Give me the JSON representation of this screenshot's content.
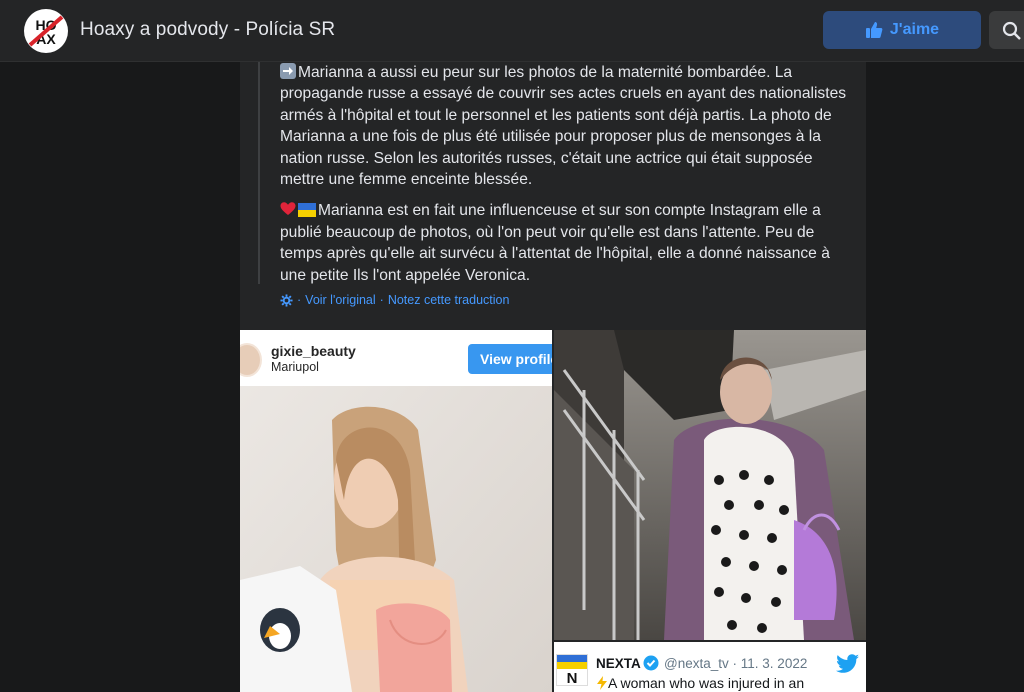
{
  "header": {
    "logo_label": "HOAX",
    "page_name": "Hoaxy a podvody - Polícia SR",
    "like_label": "J'aime",
    "colors": {
      "bar": "#242526",
      "like_bg": "#2d4b7c",
      "like_text": "#4599ff"
    }
  },
  "post": {
    "paragraph1": "Marianna a aussi eu peur sur les photos de la maternité bombardée. La propagande russe a essayé de couvrir ses actes cruels en ayant des nationalistes armés à l'hôpital et tout le personnel et les patients sont déjà partis. La photo de Marianna a une fois de plus été utilisée pour proposer plus de mensonges à la nation russe. Selon les autorités russes, c'était une actrice qui était supposée mettre une femme enceinte blessée.",
    "paragraph1_icon": "right-arrow-emoji",
    "paragraph2": "Marianna est en fait une influenceuse et sur son compte Instagram elle a publié beaucoup de photos, où l'on peut voir qu'elle est dans l'attente. Peu de temps après qu'elle ait survécu à l'attentat de l'hôpital, elle a donné naissance à une petite Ils l'ont appelée Veronica.",
    "paragraph2_icons": [
      "red-heart-emoji",
      "ukraine-flag-emoji"
    ],
    "translation": {
      "see_original": "Voir l'original",
      "rate_translation": "Notez cette traduction",
      "separator": "·"
    }
  },
  "instagram": {
    "username": "gixie_beauty",
    "location": "Mariupol",
    "button": "View profile"
  },
  "tweet": {
    "name": "NEXTA",
    "handle": "@nexta_tv",
    "date": "11. 3. 2022",
    "separator": "·",
    "text": "A woman who was injured in an",
    "icon": "lightning-emoji",
    "avatar_letter": "N"
  }
}
